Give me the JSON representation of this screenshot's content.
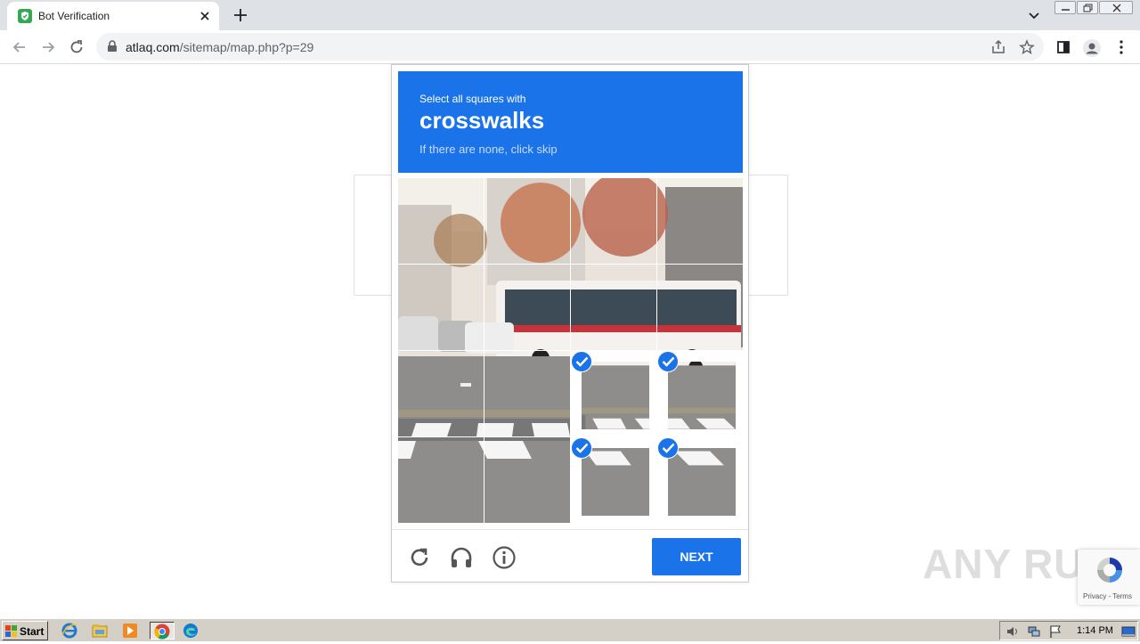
{
  "browser": {
    "tab_title": "Bot Verification",
    "url_host": "atlaq.com",
    "url_path": "/sitemap/map.php?p=29"
  },
  "captcha": {
    "instruction": "Select all squares with",
    "target": "crosswalks",
    "hint": "If there are none, click skip",
    "next_label": "NEXT",
    "tiles": [
      {
        "selected": false
      },
      {
        "selected": false
      },
      {
        "selected": false
      },
      {
        "selected": false
      },
      {
        "selected": false
      },
      {
        "selected": false
      },
      {
        "selected": false
      },
      {
        "selected": false
      },
      {
        "selected": false
      },
      {
        "selected": false
      },
      {
        "selected": true
      },
      {
        "selected": true
      },
      {
        "selected": false
      },
      {
        "selected": false
      },
      {
        "selected": true
      },
      {
        "selected": true
      }
    ]
  },
  "recaptcha": {
    "terms": "Privacy - Terms"
  },
  "watermark": "ANY RUN",
  "taskbar": {
    "start_label": "Start",
    "clock": "1:14 PM"
  },
  "colors": {
    "accent": "#1a73e8",
    "chrome_tabstrip": "#dee1e6",
    "taskbar": "#d4d0c8"
  }
}
